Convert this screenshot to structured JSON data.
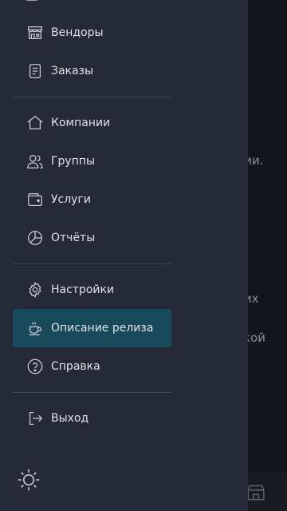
{
  "background": {
    "fragments": [
      "сии.",
      "их",
      "кой"
    ]
  },
  "drawer": {
    "items": [
      {
        "label": "Вендоры",
        "icon": "store-icon"
      },
      {
        "label": "Заказы",
        "icon": "document-icon"
      },
      {
        "label": "Компании",
        "icon": "home-icon"
      },
      {
        "label": "Группы",
        "icon": "users-icon"
      },
      {
        "label": "Услуги",
        "icon": "wallet-icon"
      },
      {
        "label": "Отчёты",
        "icon": "pie-chart-icon"
      },
      {
        "label": "Настройки",
        "icon": "gear-icon"
      },
      {
        "label": "Описание релиза",
        "icon": "coffee-cup-icon",
        "active": true
      },
      {
        "label": "Справка",
        "icon": "help-circle-icon"
      },
      {
        "label": "Выход",
        "icon": "logout-icon"
      }
    ],
    "theme_toggle_icon": "sun-icon"
  },
  "colors": {
    "drawer_bg": "#262a38",
    "active_bg": "#194a5b",
    "text": "#dfe1e7",
    "divider": "#424757"
  }
}
